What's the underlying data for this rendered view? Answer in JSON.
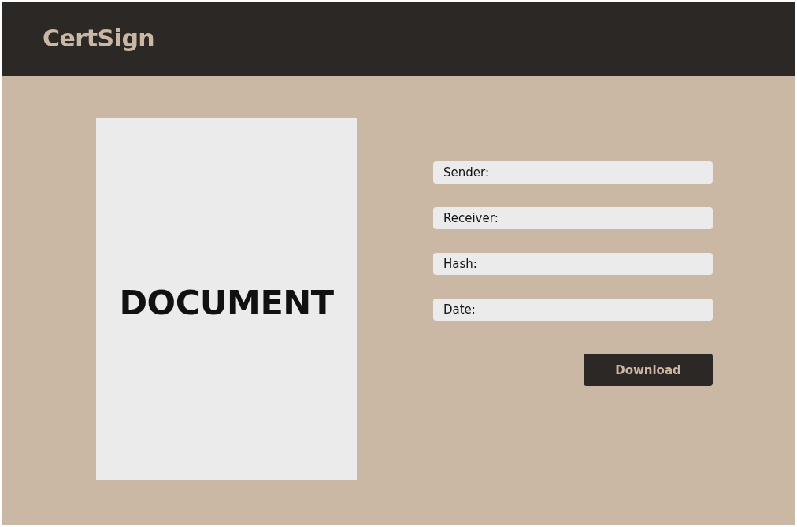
{
  "header": {
    "logo": "CertSign"
  },
  "document": {
    "title": "DOCUMENT"
  },
  "fields": [
    {
      "label": "Sender:"
    },
    {
      "label": "Receiver:"
    },
    {
      "label": "Hash:"
    },
    {
      "label": "Date:"
    }
  ],
  "button": {
    "label": "Download"
  }
}
